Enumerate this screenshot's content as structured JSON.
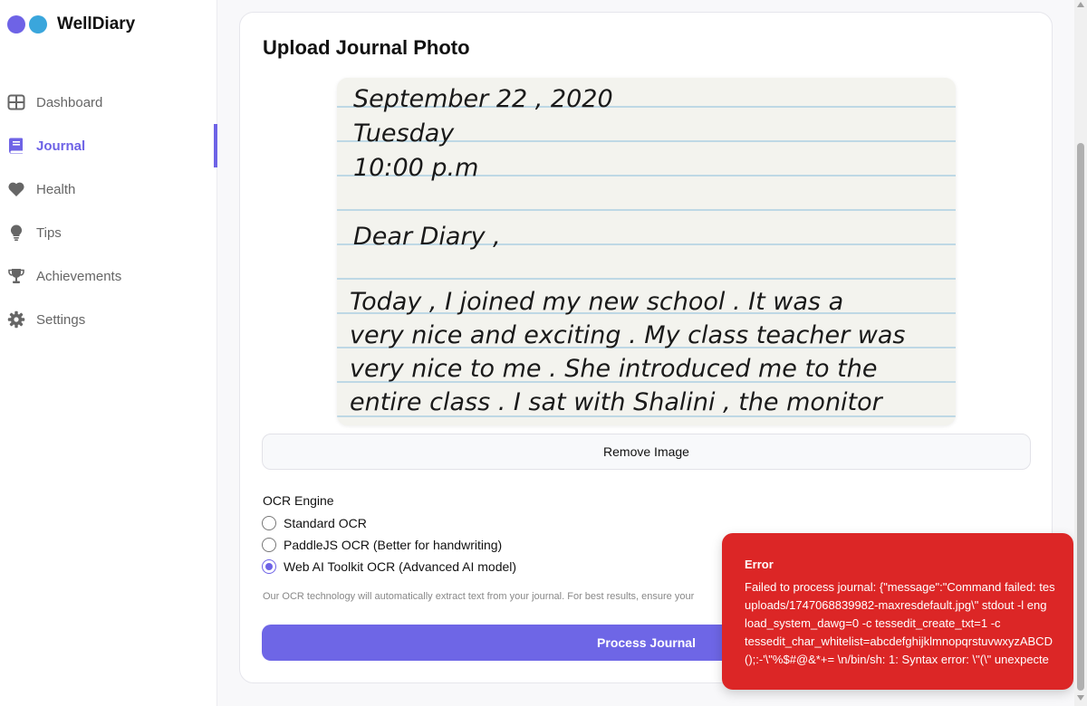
{
  "app": {
    "name": "WellDiary"
  },
  "nav": {
    "items": [
      {
        "label": "Dashboard",
        "icon": "dashboard-grid-icon",
        "active": false
      },
      {
        "label": "Journal",
        "icon": "book-icon",
        "active": true
      },
      {
        "label": "Health",
        "icon": "heart-icon",
        "active": false
      },
      {
        "label": "Tips",
        "icon": "lightbulb-icon",
        "active": false
      },
      {
        "label": "Achievements",
        "icon": "trophy-icon",
        "active": false
      },
      {
        "label": "Settings",
        "icon": "gear-icon",
        "active": false
      }
    ]
  },
  "upload": {
    "title": "Upload Journal Photo",
    "photo_lines": [
      "September  22 , 2020",
      "Tuesday",
      "10:00  p.m",
      "Dear  Diary ,",
      "Today ,  I  joined  my  new  school . It  was  a",
      "very  nice  and  exciting . My  class  teacher  was",
      "very  nice  to  me . She  introduced  me  to  the",
      "entire  class . I  sat  with  Shalini , the  monitor"
    ],
    "remove_label": "Remove Image"
  },
  "ocr": {
    "label": "OCR Engine",
    "options": [
      {
        "label": "Standard OCR",
        "checked": false
      },
      {
        "label": "PaddleJS OCR (Better for handwriting)",
        "checked": false
      },
      {
        "label": "Web AI Toolkit OCR (Advanced AI model)",
        "checked": true
      }
    ],
    "help": "Our OCR technology will automatically extract text from your journal. For best results, ensure your",
    "process_label": "Process Journal"
  },
  "toast": {
    "title": "Error",
    "message": "Failed to process journal: {\"message\":\"Command failed: tes\nuploads/1747068839982-maxresdefault.jpg\\\" stdout -l eng\nload_system_dawg=0 -c tessedit_create_txt=1 -c\ntessedit_char_whitelist=abcdefghijklmnopqrstuvwxyzABCD\n();:-'\\\"%$#@&*+= \\n/bin/sh: 1: Syntax error: \\\"(\\\" unexpecte",
    "color": "#dc2626"
  },
  "colors": {
    "accent": "#6e63e6",
    "logo_second": "#3aa6dc"
  }
}
